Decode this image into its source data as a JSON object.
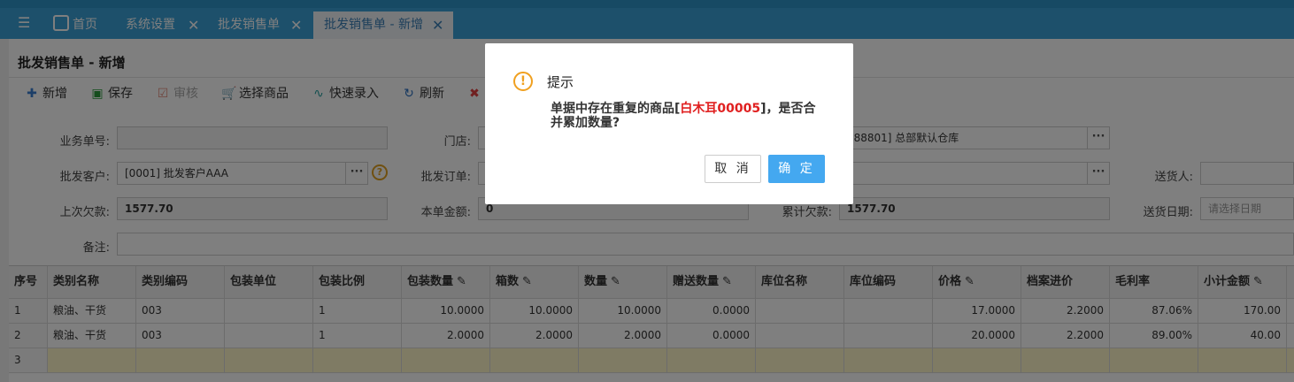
{
  "tabs": [
    {
      "label": "首页",
      "closable": false,
      "active": false
    },
    {
      "label": "系统设置",
      "closable": true,
      "active": false
    },
    {
      "label": "批发销售单",
      "closable": true,
      "active": false
    },
    {
      "label": "批发销售单 - 新增",
      "closable": true,
      "active": true
    }
  ],
  "close_glyph": "✕",
  "page_title": "批发销售单 - 新增",
  "toolbar": {
    "new": "新增",
    "save": "保存",
    "audit": "审核",
    "select_goods": "选择商品",
    "quick_entry": "快速录入",
    "refresh": "刷新"
  },
  "form": {
    "order_no_label": "业务单号:",
    "order_no_value": "",
    "store_label": "门店:",
    "warehouse_value": "888801] 总部默认仓库",
    "customer_label": "批发客户:",
    "customer_value": "[0001] 批发客户AAA",
    "wholesale_order_label": "批发订单:",
    "deliverer_label": "送货人:",
    "last_debt_label": "上次欠款:",
    "last_debt_value": "1577.70",
    "this_amount_label": "本单金额:",
    "this_amount_value": "0",
    "total_debt_label": "累计欠款:",
    "total_debt_value": "1577.70",
    "delivery_date_label": "送货日期:",
    "delivery_date_placeholder": "请选择日期",
    "remark_label": "备注:",
    "dots": "···",
    "help": "?"
  },
  "grid": {
    "headers": [
      "序号",
      "类别名称",
      "类别编码",
      "包装单位",
      "包装比例",
      "包装数量",
      "箱数",
      "数量",
      "赠送数量",
      "库位名称",
      "库位编码",
      "价格",
      "档案进价",
      "毛利率",
      "小计金额"
    ],
    "editable": [
      false,
      false,
      false,
      false,
      false,
      true,
      true,
      true,
      true,
      false,
      false,
      true,
      false,
      false,
      true
    ],
    "pen_glyph": "✎",
    "rows": [
      [
        "1",
        "粮油、干货",
        "003",
        "",
        "1",
        "10.0000",
        "10.0000",
        "10.0000",
        "0.0000",
        "",
        "",
        "17.0000",
        "2.2000",
        "87.06%",
        "170.00"
      ],
      [
        "2",
        "粮油、干货",
        "003",
        "",
        "1",
        "2.0000",
        "2.0000",
        "2.0000",
        "0.0000",
        "",
        "",
        "20.0000",
        "2.2000",
        "89.00%",
        "40.00"
      ],
      [
        "3",
        "",
        "",
        "",
        "",
        "",
        "",
        "",
        "",
        "",
        "",
        "",
        "",
        "",
        ""
      ]
    ],
    "new_row_color": "#fff6c8"
  },
  "dialog": {
    "title": "提示",
    "warn_glyph": "!",
    "message_before": "单据中存在重复的商品[",
    "message_highlight": "白木耳00005",
    "message_after": "]，是否合并累加数量?",
    "cancel": "取 消",
    "confirm": "确 定"
  },
  "colors": {
    "tabbar": "#3aa0d6",
    "primary_button": "#44a8f0",
    "highlight_text": "#e02020",
    "warning": "#f0a020"
  }
}
